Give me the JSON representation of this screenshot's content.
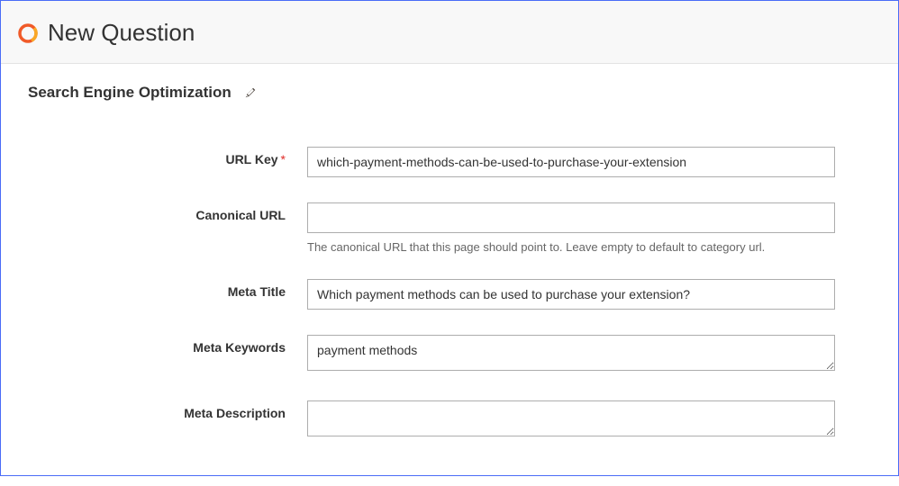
{
  "header": {
    "title": "New Question"
  },
  "section": {
    "title": "Search Engine Optimization"
  },
  "fields": {
    "url_key": {
      "label": "URL Key",
      "required": true,
      "value": "which-payment-methods-can-be-used-to-purchase-your-extension"
    },
    "canonical_url": {
      "label": "Canonical URL",
      "value": "",
      "hint": "The canonical URL that this page should point to. Leave empty to default to category url."
    },
    "meta_title": {
      "label": "Meta Title",
      "value": "Which payment methods can be used to purchase your extension?"
    },
    "meta_keywords": {
      "label": "Meta Keywords",
      "value": "payment methods"
    },
    "meta_description": {
      "label": "Meta Description",
      "value": ""
    }
  }
}
